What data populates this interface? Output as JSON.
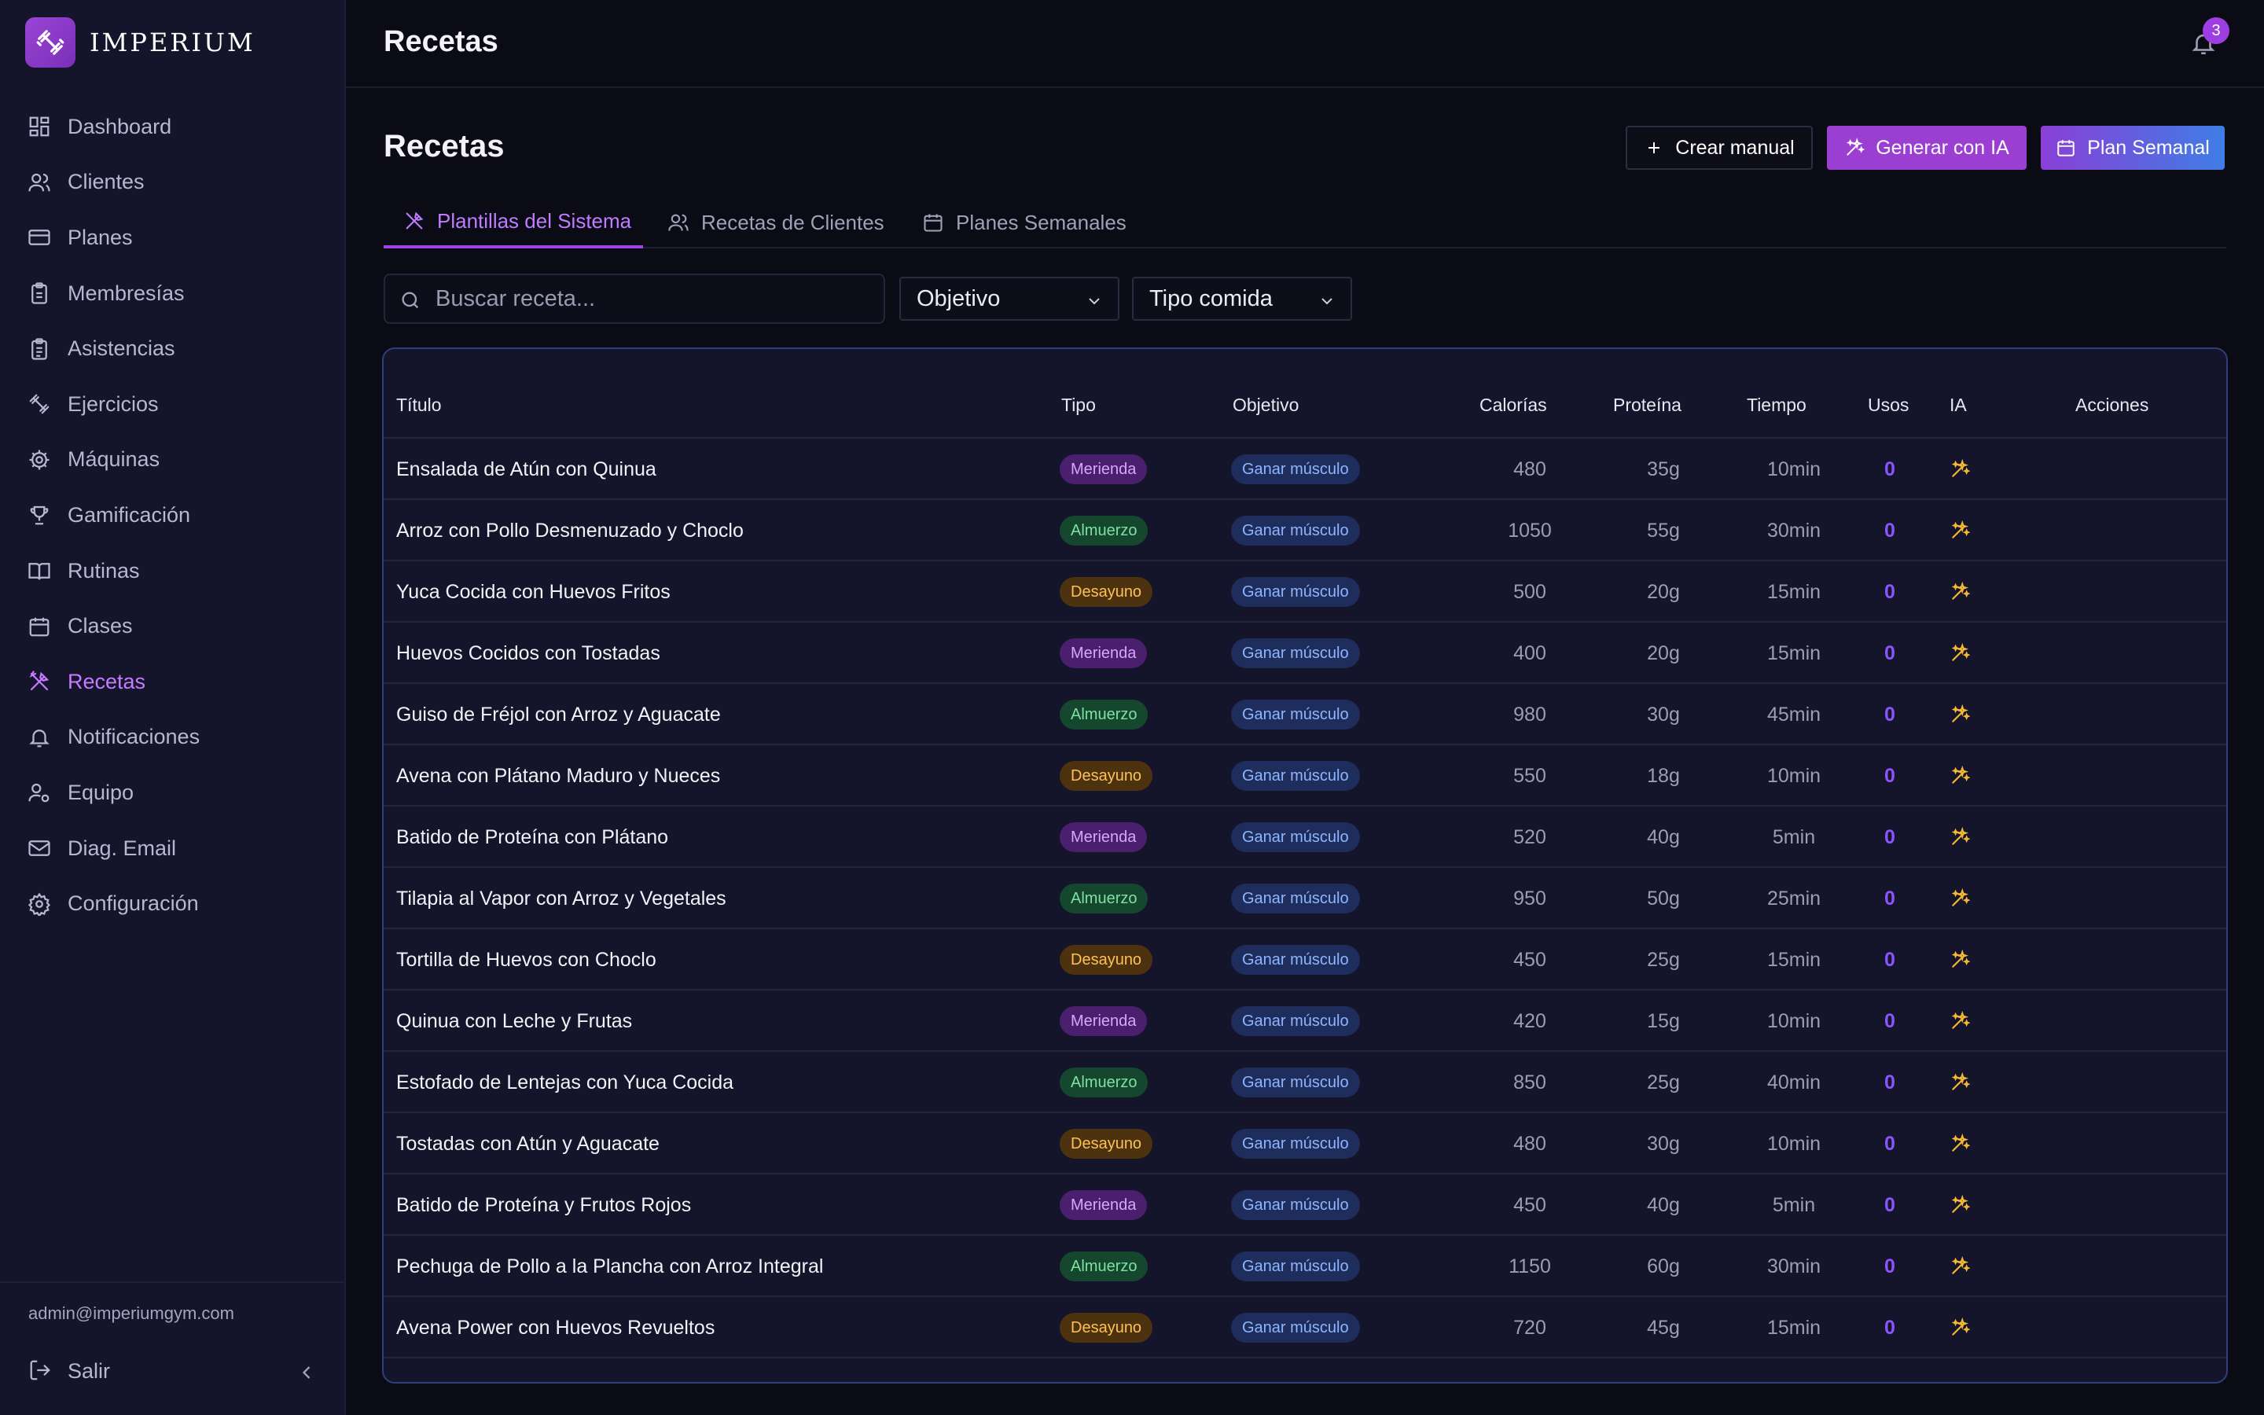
{
  "brand": {
    "name": "IMPERIUM"
  },
  "sidebar": {
    "items": [
      {
        "label": "Dashboard",
        "icon": "dashboard-icon",
        "active": false
      },
      {
        "label": "Clientes",
        "icon": "users-icon",
        "active": false
      },
      {
        "label": "Planes",
        "icon": "credit-card-icon",
        "active": false
      },
      {
        "label": "Membresías",
        "icon": "clipboard-icon",
        "active": false
      },
      {
        "label": "Asistencias",
        "icon": "clipboard-check-icon",
        "active": false
      },
      {
        "label": "Ejercicios",
        "icon": "dumbbell-icon",
        "active": false
      },
      {
        "label": "Máquinas",
        "icon": "cog-icon",
        "active": false
      },
      {
        "label": "Gamificación",
        "icon": "trophy-icon",
        "active": false
      },
      {
        "label": "Rutinas",
        "icon": "book-icon",
        "active": false
      },
      {
        "label": "Clases",
        "icon": "calendar-icon",
        "active": false
      },
      {
        "label": "Recetas",
        "icon": "utensils-icon",
        "active": true
      },
      {
        "label": "Notificaciones",
        "icon": "bell-icon",
        "active": false
      },
      {
        "label": "Equipo",
        "icon": "user-cog-icon",
        "active": false
      },
      {
        "label": "Diag. Email",
        "icon": "mail-icon",
        "active": false
      },
      {
        "label": "Configuración",
        "icon": "settings-icon",
        "active": false
      }
    ],
    "user_email": "admin@imperiumgym.com",
    "logout_label": "Salir"
  },
  "header": {
    "title": "Recetas",
    "notifications_count": "3"
  },
  "main": {
    "title": "Recetas",
    "buttons": {
      "manual": "Crear manual",
      "ia": "Generar con IA",
      "plan": "Plan Semanal"
    },
    "tabs": [
      {
        "label": "Plantillas del Sistema",
        "active": true
      },
      {
        "label": "Recetas de Clientes",
        "active": false
      },
      {
        "label": "Planes Semanales",
        "active": false
      }
    ],
    "search": {
      "placeholder": "Buscar receta...",
      "value": ""
    },
    "filters": {
      "objetivo": "Objetivo",
      "tipo": "Tipo comida"
    }
  },
  "table": {
    "headers": {
      "titulo": "Título",
      "tipo": "Tipo",
      "objetivo": "Objetivo",
      "calorias": "Calorías",
      "proteina": "Proteína",
      "tiempo": "Tiempo",
      "usos": "Usos",
      "ia": "IA",
      "acciones": "Acciones"
    },
    "rows": [
      {
        "title": "Ensalada de Atún con Quinua",
        "tipo": "Merienda",
        "objetivo": "Ganar músculo",
        "calorias": "480",
        "proteina": "35g",
        "tiempo": "10min",
        "usos": "0"
      },
      {
        "title": "Arroz con Pollo Desmenuzado y Choclo",
        "tipo": "Almuerzo",
        "objetivo": "Ganar músculo",
        "calorias": "1050",
        "proteina": "55g",
        "tiempo": "30min",
        "usos": "0"
      },
      {
        "title": "Yuca Cocida con Huevos Fritos",
        "tipo": "Desayuno",
        "objetivo": "Ganar músculo",
        "calorias": "500",
        "proteina": "20g",
        "tiempo": "15min",
        "usos": "0"
      },
      {
        "title": "Huevos Cocidos con Tostadas",
        "tipo": "Merienda",
        "objetivo": "Ganar músculo",
        "calorias": "400",
        "proteina": "20g",
        "tiempo": "15min",
        "usos": "0"
      },
      {
        "title": "Guiso de Fréjol con Arroz y Aguacate",
        "tipo": "Almuerzo",
        "objetivo": "Ganar músculo",
        "calorias": "980",
        "proteina": "30g",
        "tiempo": "45min",
        "usos": "0"
      },
      {
        "title": "Avena con Plátano Maduro y Nueces",
        "tipo": "Desayuno",
        "objetivo": "Ganar músculo",
        "calorias": "550",
        "proteina": "18g",
        "tiempo": "10min",
        "usos": "0"
      },
      {
        "title": "Batido de Proteína con Plátano",
        "tipo": "Merienda",
        "objetivo": "Ganar músculo",
        "calorias": "520",
        "proteina": "40g",
        "tiempo": "5min",
        "usos": "0"
      },
      {
        "title": "Tilapia al Vapor con Arroz y Vegetales",
        "tipo": "Almuerzo",
        "objetivo": "Ganar músculo",
        "calorias": "950",
        "proteina": "50g",
        "tiempo": "25min",
        "usos": "0"
      },
      {
        "title": "Tortilla de Huevos con Choclo",
        "tipo": "Desayuno",
        "objetivo": "Ganar músculo",
        "calorias": "450",
        "proteina": "25g",
        "tiempo": "15min",
        "usos": "0"
      },
      {
        "title": "Quinua con Leche y Frutas",
        "tipo": "Merienda",
        "objetivo": "Ganar músculo",
        "calorias": "420",
        "proteina": "15g",
        "tiempo": "10min",
        "usos": "0"
      },
      {
        "title": "Estofado de Lentejas con Yuca Cocida",
        "tipo": "Almuerzo",
        "objetivo": "Ganar músculo",
        "calorias": "850",
        "proteina": "25g",
        "tiempo": "40min",
        "usos": "0"
      },
      {
        "title": "Tostadas con Atún y Aguacate",
        "tipo": "Desayuno",
        "objetivo": "Ganar músculo",
        "calorias": "480",
        "proteina": "30g",
        "tiempo": "10min",
        "usos": "0"
      },
      {
        "title": "Batido de Proteína y Frutos Rojos",
        "tipo": "Merienda",
        "objetivo": "Ganar músculo",
        "calorias": "450",
        "proteina": "40g",
        "tiempo": "5min",
        "usos": "0"
      },
      {
        "title": "Pechuga de Pollo a la Plancha con Arroz Integral",
        "tipo": "Almuerzo",
        "objetivo": "Ganar músculo",
        "calorias": "1150",
        "proteina": "60g",
        "tiempo": "30min",
        "usos": "0"
      },
      {
        "title": "Avena Power con Huevos Revueltos",
        "tipo": "Desayuno",
        "objetivo": "Ganar músculo",
        "calorias": "720",
        "proteina": "45g",
        "tiempo": "15min",
        "usos": "0"
      }
    ]
  },
  "colors": {
    "accent": "#a046e8",
    "sidebar_bg": "#14142b",
    "page_bg": "#0b0b16",
    "table_border": "#2f3d78"
  }
}
